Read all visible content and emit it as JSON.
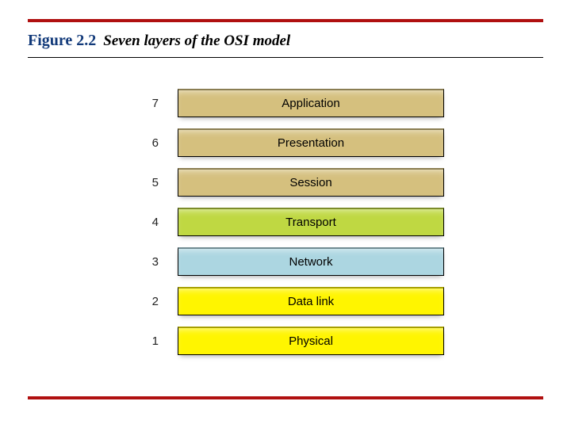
{
  "figure": {
    "label": "Figure 2.2",
    "title": "Seven layers of the OSI model"
  },
  "colors": {
    "khaki": "#d5c07e",
    "green": "#bfd842",
    "blue": "#acd6e1",
    "yellow": "#fff500"
  },
  "layers": [
    {
      "num": "7",
      "name": "Application",
      "colorKey": "khaki"
    },
    {
      "num": "6",
      "name": "Presentation",
      "colorKey": "khaki"
    },
    {
      "num": "5",
      "name": "Session",
      "colorKey": "khaki"
    },
    {
      "num": "4",
      "name": "Transport",
      "colorKey": "green"
    },
    {
      "num": "3",
      "name": "Network",
      "colorKey": "blue"
    },
    {
      "num": "2",
      "name": "Data link",
      "colorKey": "yellow"
    },
    {
      "num": "1",
      "name": "Physical",
      "colorKey": "yellow"
    }
  ]
}
